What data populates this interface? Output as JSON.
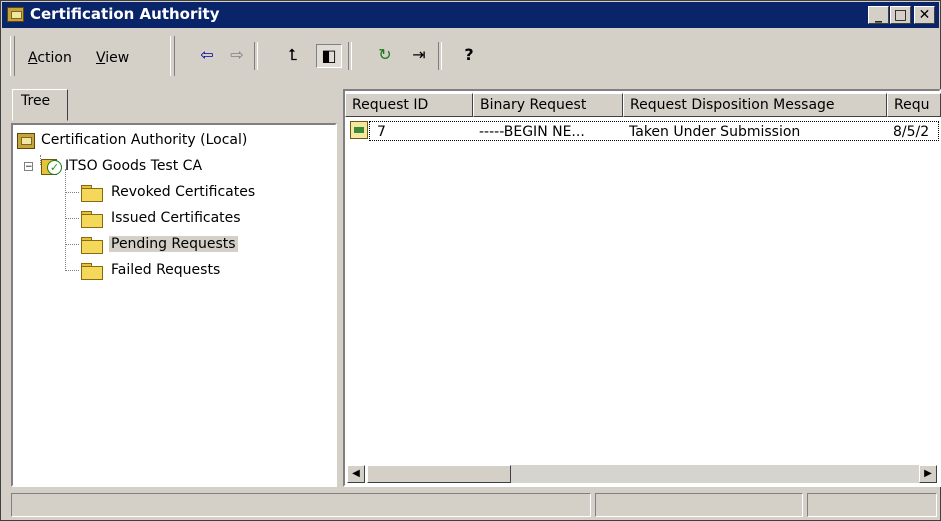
{
  "window": {
    "title": "Certification Authority",
    "title_icon": "certification-authority-icon"
  },
  "title_buttons": {
    "minimize": "_",
    "maximize": "□",
    "close": "✕"
  },
  "menu": {
    "action": {
      "accel": "A",
      "rest": "ction"
    },
    "view": {
      "accel": "V",
      "rest": "iew"
    }
  },
  "toolbar": {
    "back": "⇦",
    "forward": "⇨",
    "up": "⮤",
    "show_tree": "◧",
    "refresh": "↻",
    "export": "⇥",
    "help": "?"
  },
  "tree_tab": {
    "label": "Tree"
  },
  "tree": {
    "root": "Certification Authority (Local)",
    "ca": "ITSO Goods Test CA",
    "expander": "−",
    "folders": [
      "Revoked Certificates",
      "Issued Certificates",
      "Pending Requests",
      "Failed Requests"
    ],
    "selected": "Pending Requests"
  },
  "list": {
    "columns": [
      "Request ID",
      "Binary Request",
      "Request Disposition Message",
      "Requ"
    ],
    "rows": [
      {
        "request_id": "7",
        "binary_request": "-----BEGIN NE...",
        "disposition": "Taken Under Submission",
        "date": "8/5/2"
      }
    ]
  },
  "scrollbar": {
    "left_arrow": "◀",
    "right_arrow": "▶"
  },
  "status": {
    "panel1": "",
    "panel2": "",
    "panel3": ""
  }
}
